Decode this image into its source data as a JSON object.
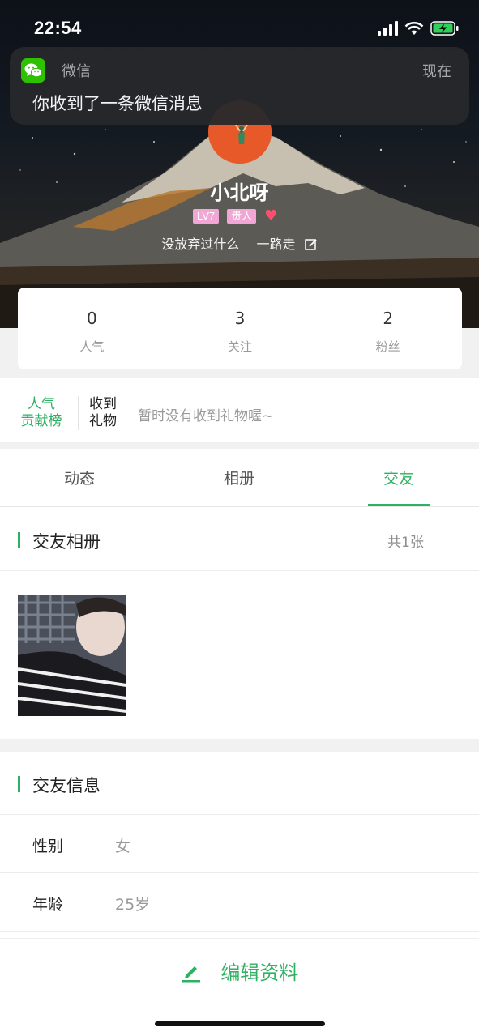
{
  "status_bar": {
    "time": "22:54"
  },
  "notification": {
    "app_icon": "wechat-icon",
    "app_name": "微信",
    "time": "现在",
    "message": "你收到了一条微信消息"
  },
  "profile": {
    "username": "小北呀",
    "level_badge": "LV7",
    "rank_badge": "贵人",
    "signature": "没放弃过什么　 一路走",
    "edit_icon": "edit-icon"
  },
  "stats": [
    {
      "value": "0",
      "label": "人气"
    },
    {
      "value": "3",
      "label": "关注"
    },
    {
      "value": "2",
      "label": "粉丝"
    }
  ],
  "gifts": {
    "rank_line1": "人气",
    "rank_line2": "贡献榜",
    "received_line1": "收到",
    "received_line2": "礼物",
    "empty_text": "暂时没有收到礼物喔~"
  },
  "tabs": [
    {
      "label": "动态"
    },
    {
      "label": "相册"
    },
    {
      "label": "交友",
      "active": true
    }
  ],
  "album": {
    "title": "交友相册",
    "count": "共1张"
  },
  "info": {
    "title": "交友信息",
    "rows": [
      {
        "label": "性别",
        "value": "女"
      },
      {
        "label": "年龄",
        "value": "25岁"
      }
    ]
  },
  "bottom": {
    "edit_label": "编辑资料",
    "icon": "pencil-icon"
  },
  "colors": {
    "accent": "#2fb163",
    "badge_pink": "#f2a6d6",
    "avatar_orange": "#e8592a"
  }
}
